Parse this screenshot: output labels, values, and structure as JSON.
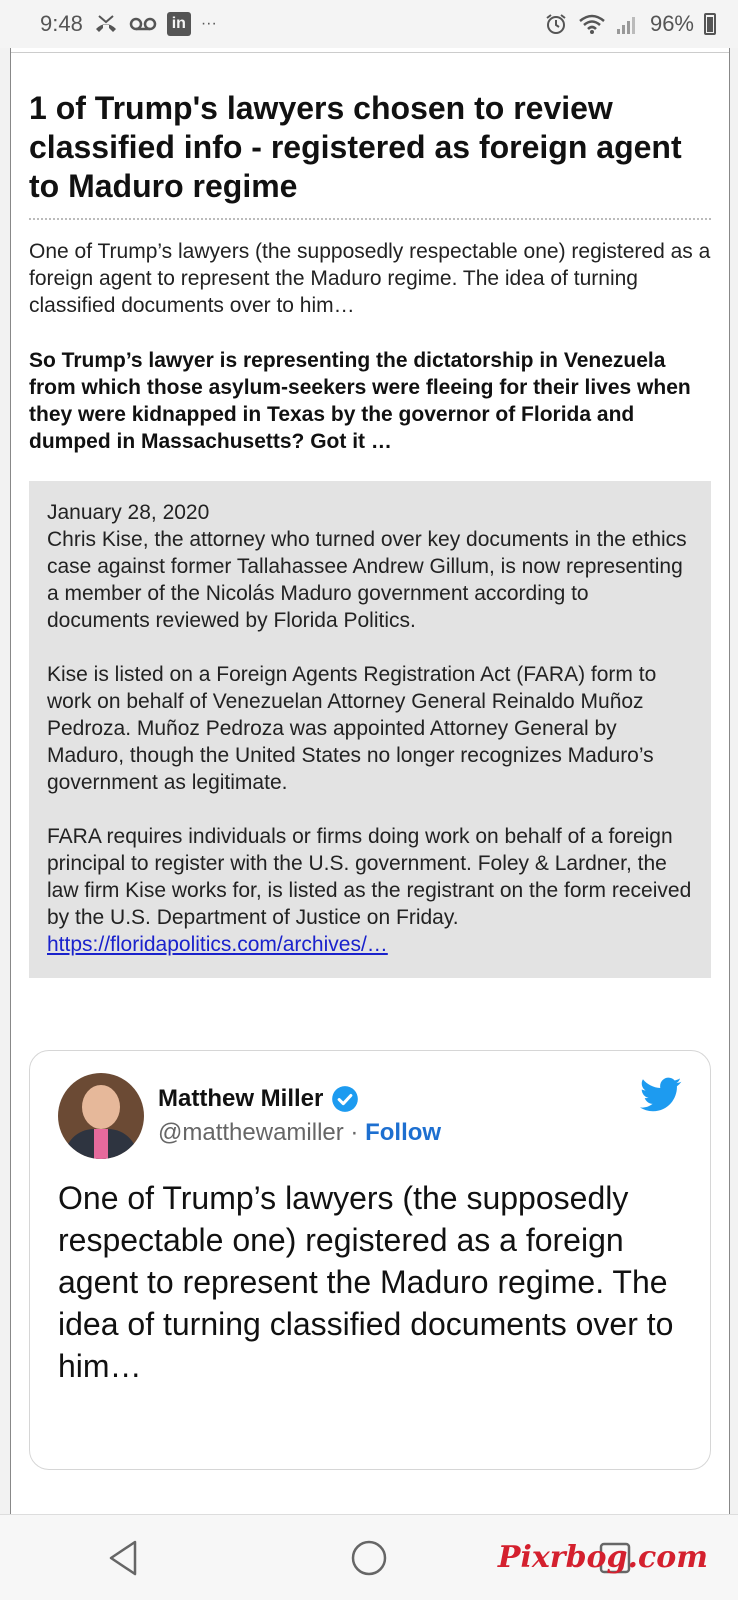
{
  "status_bar": {
    "time": "9:48",
    "linkedin": "in",
    "more": "···",
    "battery_percent": "96%",
    "icons": [
      "missed-call-icon",
      "voicemail-icon",
      "linkedin-icon",
      "alarm-icon",
      "wifi-icon",
      "signal-icon",
      "battery-icon"
    ]
  },
  "article": {
    "title": "1 of Trump's lawyers chosen to review classified info - registered as foreign agent to Maduro regime",
    "intro": "One of Trump’s lawyers (the supposedly respectable one) registered as a foreign agent to represent the Maduro regime. The idea of turning classified documents over to him…",
    "bold_paragraph": "So Trump’s lawyer is representing the dictatorship in Venezuela from which those asylum-seekers were fleeing for their lives when they were kidnapped in Texas by the governor of Florida and dumped in Massachusetts? Got it …"
  },
  "quote": {
    "date": "January 28, 2020",
    "para1": "Chris Kise, the attorney who turned over key documents in the ethics case against former Tallahassee Andrew Gillum, is now representing a member of the Nicolás Maduro government according to documents reviewed by Florida Politics.",
    "para2": "Kise is listed on a Foreign Agents Registration Act (FARA) form to work on behalf of Venezuelan Attorney General Reinaldo Muñoz Pedroza. Muñoz Pedroza was appointed Attorney General by Maduro, though the United States no longer recognizes Maduro’s government as legitimate.",
    "para3": "FARA requires individuals or firms doing work on behalf of a foreign principal to register with the U.S. government. Foley & Lardner, the law firm Kise works for, is listed as the registrant on the form received by the U.S. Department of Justice on Friday.",
    "link_text": "https://floridapolitics.com/archives/…"
  },
  "tweet": {
    "name": "Matthew Miller",
    "handle": "@matthewamiller",
    "separator": " · ",
    "follow_label": "Follow",
    "text": "One of Trump’s lawyers (the supposedly respectable one) registered as a foreign agent to represent the Maduro regime. The idea of turning classified documents over to him…"
  },
  "watermark": "Pixrbog.com",
  "colors": {
    "link": "#1a22cc",
    "follow": "#1d6fd0",
    "twitter_blue": "#1d9bf0",
    "quote_bg": "#e3e3e3",
    "watermark": "#d4202e"
  }
}
